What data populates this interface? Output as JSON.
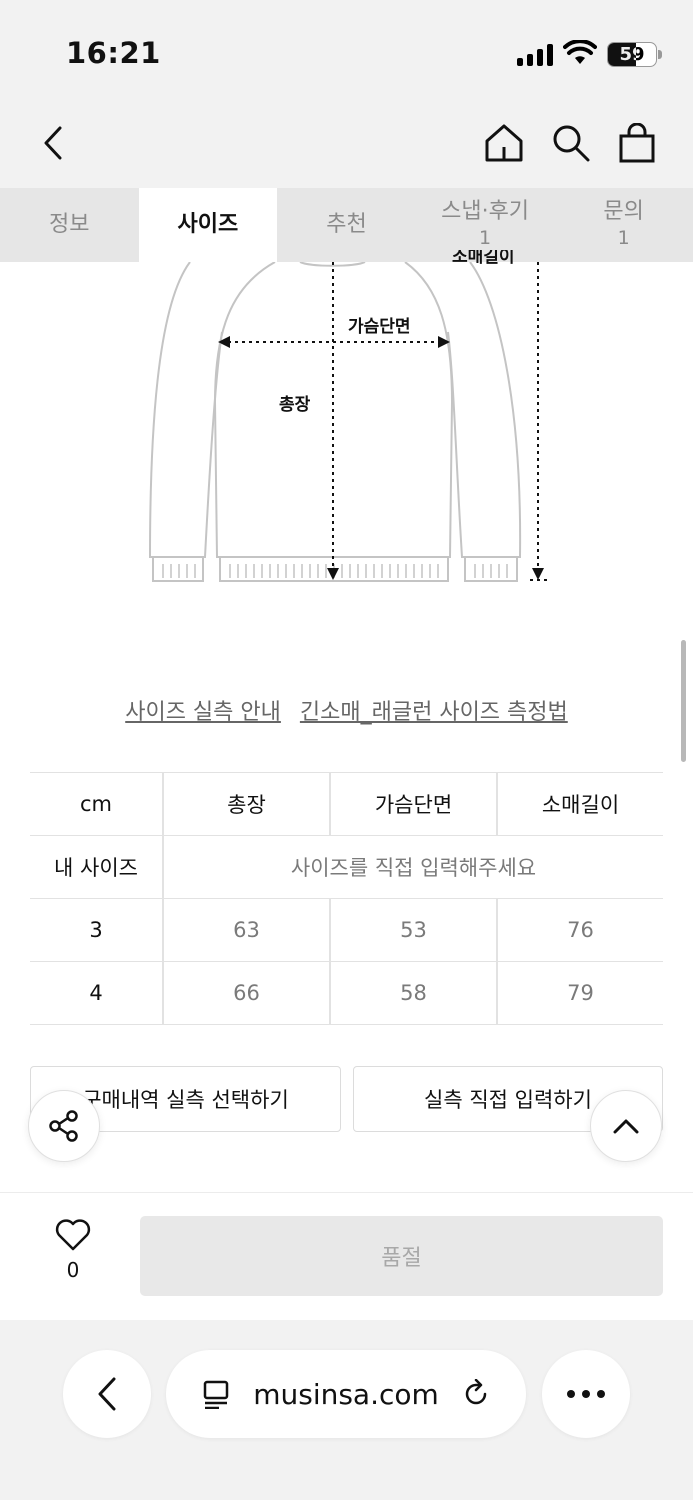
{
  "status_bar": {
    "time": "16:21",
    "battery": "59"
  },
  "nav": {
    "back_icon": "chevron-left-icon",
    "home_icon": "home-icon",
    "search_icon": "search-icon",
    "cart_icon": "shopping-bag-icon"
  },
  "tabs": [
    {
      "label": "정보",
      "count": ""
    },
    {
      "label": "사이즈",
      "count": ""
    },
    {
      "label": "추천",
      "count": ""
    },
    {
      "label": "스냅·후기",
      "count": "1"
    },
    {
      "label": "문의",
      "count": "1"
    }
  ],
  "diagram": {
    "chest_label": "가슴단면",
    "length_label": "총장",
    "sleeve_label": "소매길이"
  },
  "guide_links": {
    "actual_size": "사이즈 실측 안내",
    "measure_method": "긴소매_래글런 사이즈 측정법"
  },
  "size_table": {
    "headers": [
      "cm",
      "총장",
      "가슴단면",
      "소매길이"
    ],
    "my_size": {
      "label": "내 사이즈",
      "placeholder": "사이즈를 직접 입력해주세요"
    },
    "rows": [
      {
        "size": "3",
        "values": [
          "63",
          "53",
          "76"
        ]
      },
      {
        "size": "4",
        "values": [
          "66",
          "58",
          "79"
        ]
      }
    ]
  },
  "actions": {
    "select_history": "구매내역 실측 선택하기",
    "manual_input": "실측 직접 입력하기"
  },
  "bottom": {
    "like_count": "0",
    "soldout_label": "품절"
  },
  "browser": {
    "url": "musinsa.com"
  }
}
